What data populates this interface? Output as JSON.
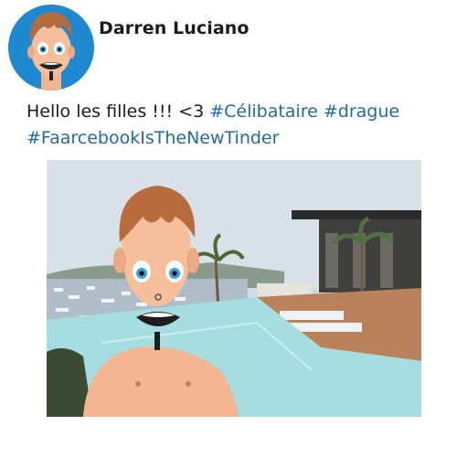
{
  "post": {
    "author": "Darren Luciano",
    "text_prefix": "Hello les filles !!! <3 ",
    "hashtags": [
      "#Célibataire",
      "#drague",
      "#FaarcebookIsTheNewTinder"
    ],
    "image_description_icon": "photo"
  }
}
